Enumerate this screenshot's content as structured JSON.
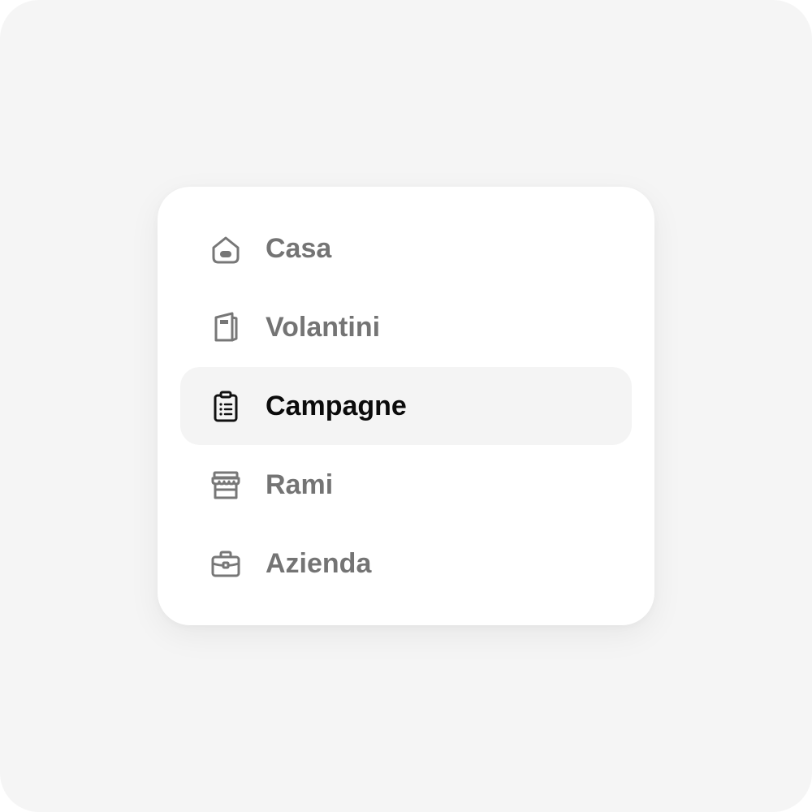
{
  "colors": {
    "background": "#f5f5f5",
    "card": "#ffffff",
    "active_row": "#f4f4f4",
    "inactive_text": "#747474",
    "active_text": "#0b0b0b"
  },
  "nav": {
    "active": "Campagne",
    "items": [
      {
        "label": "Casa",
        "icon": "home-icon"
      },
      {
        "label": "Volantini",
        "icon": "flyer-icon"
      },
      {
        "label": "Campagne",
        "icon": "clipboard-list-icon"
      },
      {
        "label": "Rami",
        "icon": "storefront-icon"
      },
      {
        "label": "Azienda",
        "icon": "briefcase-icon"
      }
    ]
  }
}
